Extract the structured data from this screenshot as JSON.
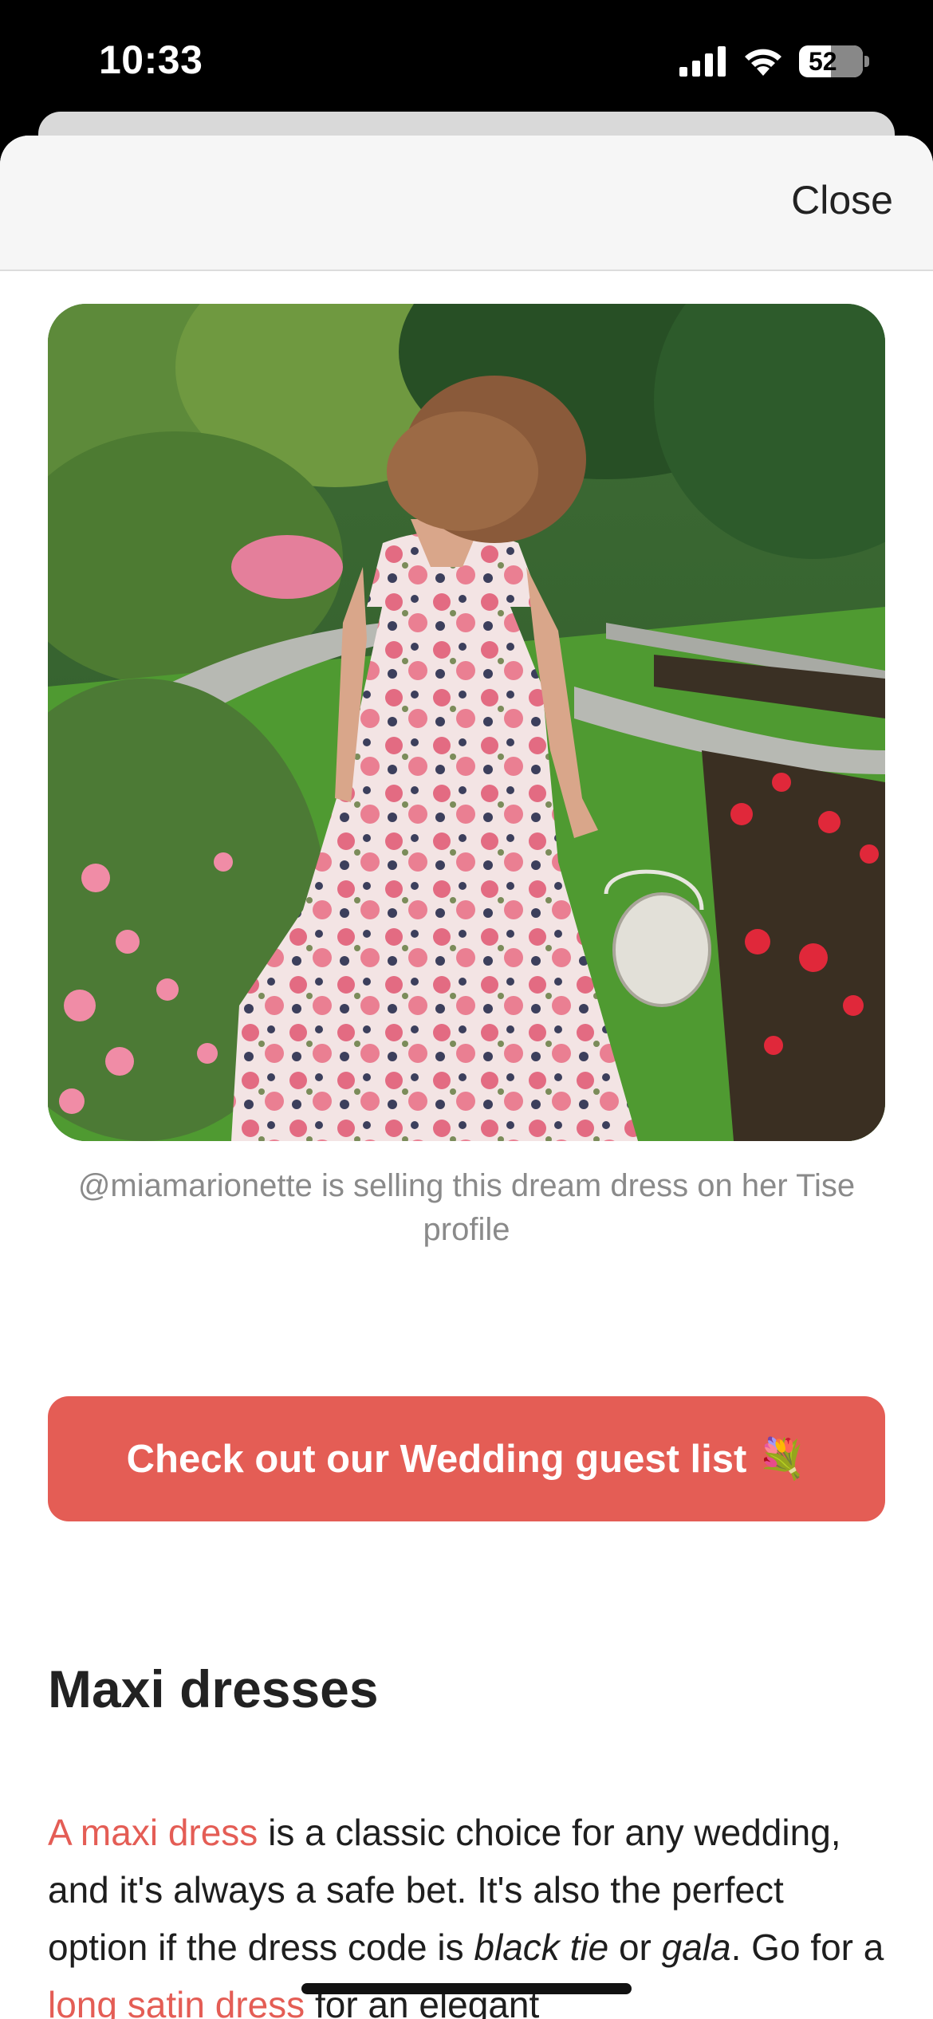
{
  "status_bar": {
    "time": "10:33",
    "battery": "52"
  },
  "header": {
    "close_label": "Close"
  },
  "hero": {
    "caption": "@miamarionette is selling this dream dress on her Tise profile"
  },
  "cta": {
    "label": "Check out our Wedding guest list",
    "emoji": "💐"
  },
  "section": {
    "title": "Maxi dresses",
    "paragraph": {
      "link1": "A maxi dress",
      "text1": " is a classic choice for any wedding, and it's always a safe bet. It's also the perfect option if the dress code is ",
      "italic1": "black tie",
      "text2": " or ",
      "italic2": "gala",
      "text3": ". Go for a ",
      "link2": "long satin dress",
      "text4": " for an elegant"
    }
  },
  "colors": {
    "accent": "#e45d55",
    "caption": "#8a8a8a"
  }
}
